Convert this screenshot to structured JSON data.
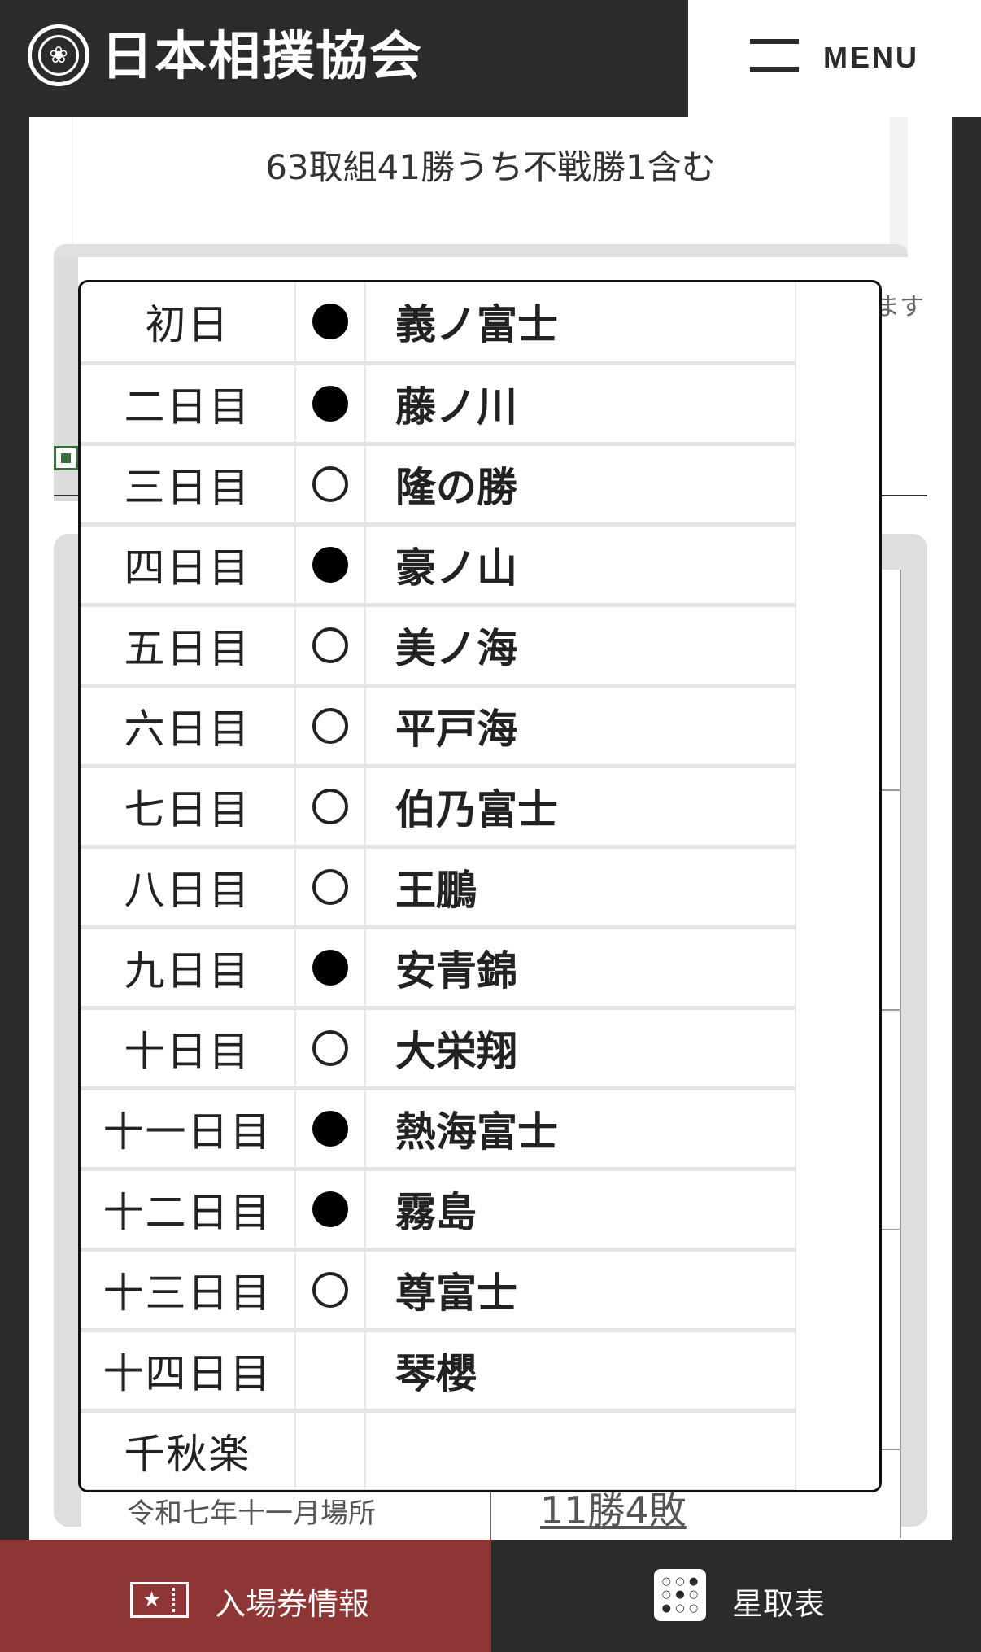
{
  "header": {
    "logo_emblem": "❀",
    "logo_text": "日本相撲協会",
    "menu_label": "MENU"
  },
  "record_summary": "63取組41勝うち不戦勝1含む",
  "side_note": "ます",
  "bouts": [
    {
      "day": "初日",
      "result": "loss",
      "opponent": "義ノ富士"
    },
    {
      "day": "二日目",
      "result": "loss",
      "opponent": "藤ノ川"
    },
    {
      "day": "三日目",
      "result": "win",
      "opponent": "隆の勝"
    },
    {
      "day": "四日目",
      "result": "loss",
      "opponent": "豪ノ山"
    },
    {
      "day": "五日目",
      "result": "win",
      "opponent": "美ノ海"
    },
    {
      "day": "六日目",
      "result": "win",
      "opponent": "平戸海"
    },
    {
      "day": "七日目",
      "result": "win",
      "opponent": "伯乃富士"
    },
    {
      "day": "八日目",
      "result": "win",
      "opponent": "王鵬"
    },
    {
      "day": "九日目",
      "result": "loss",
      "opponent": "安青錦"
    },
    {
      "day": "十日目",
      "result": "win",
      "opponent": "大栄翔"
    },
    {
      "day": "十一日目",
      "result": "loss",
      "opponent": "熱海富士"
    },
    {
      "day": "十二日目",
      "result": "loss",
      "opponent": "霧島"
    },
    {
      "day": "十三日目",
      "result": "win",
      "opponent": "尊富士"
    },
    {
      "day": "十四日目",
      "result": "",
      "opponent": "琴櫻"
    },
    {
      "day": "千秋楽",
      "result": "",
      "opponent": ""
    }
  ],
  "season": {
    "label": "令和七年十一月場所",
    "record": "11勝4敗"
  },
  "bottom_nav": {
    "ticket_label": "入場券情報",
    "ticket_icon_glyph": "★",
    "hoshitori_label": "星取表",
    "hoshitori_icon_glyphs": [
      "○",
      "○",
      "●",
      "○",
      "●",
      "○",
      "●",
      "○",
      "○"
    ]
  },
  "colors": {
    "header_bg": "#2b2b2b",
    "ticket_bg": "#8e3535",
    "loss_mark": "#000000",
    "win_mark": "#ffffff"
  }
}
